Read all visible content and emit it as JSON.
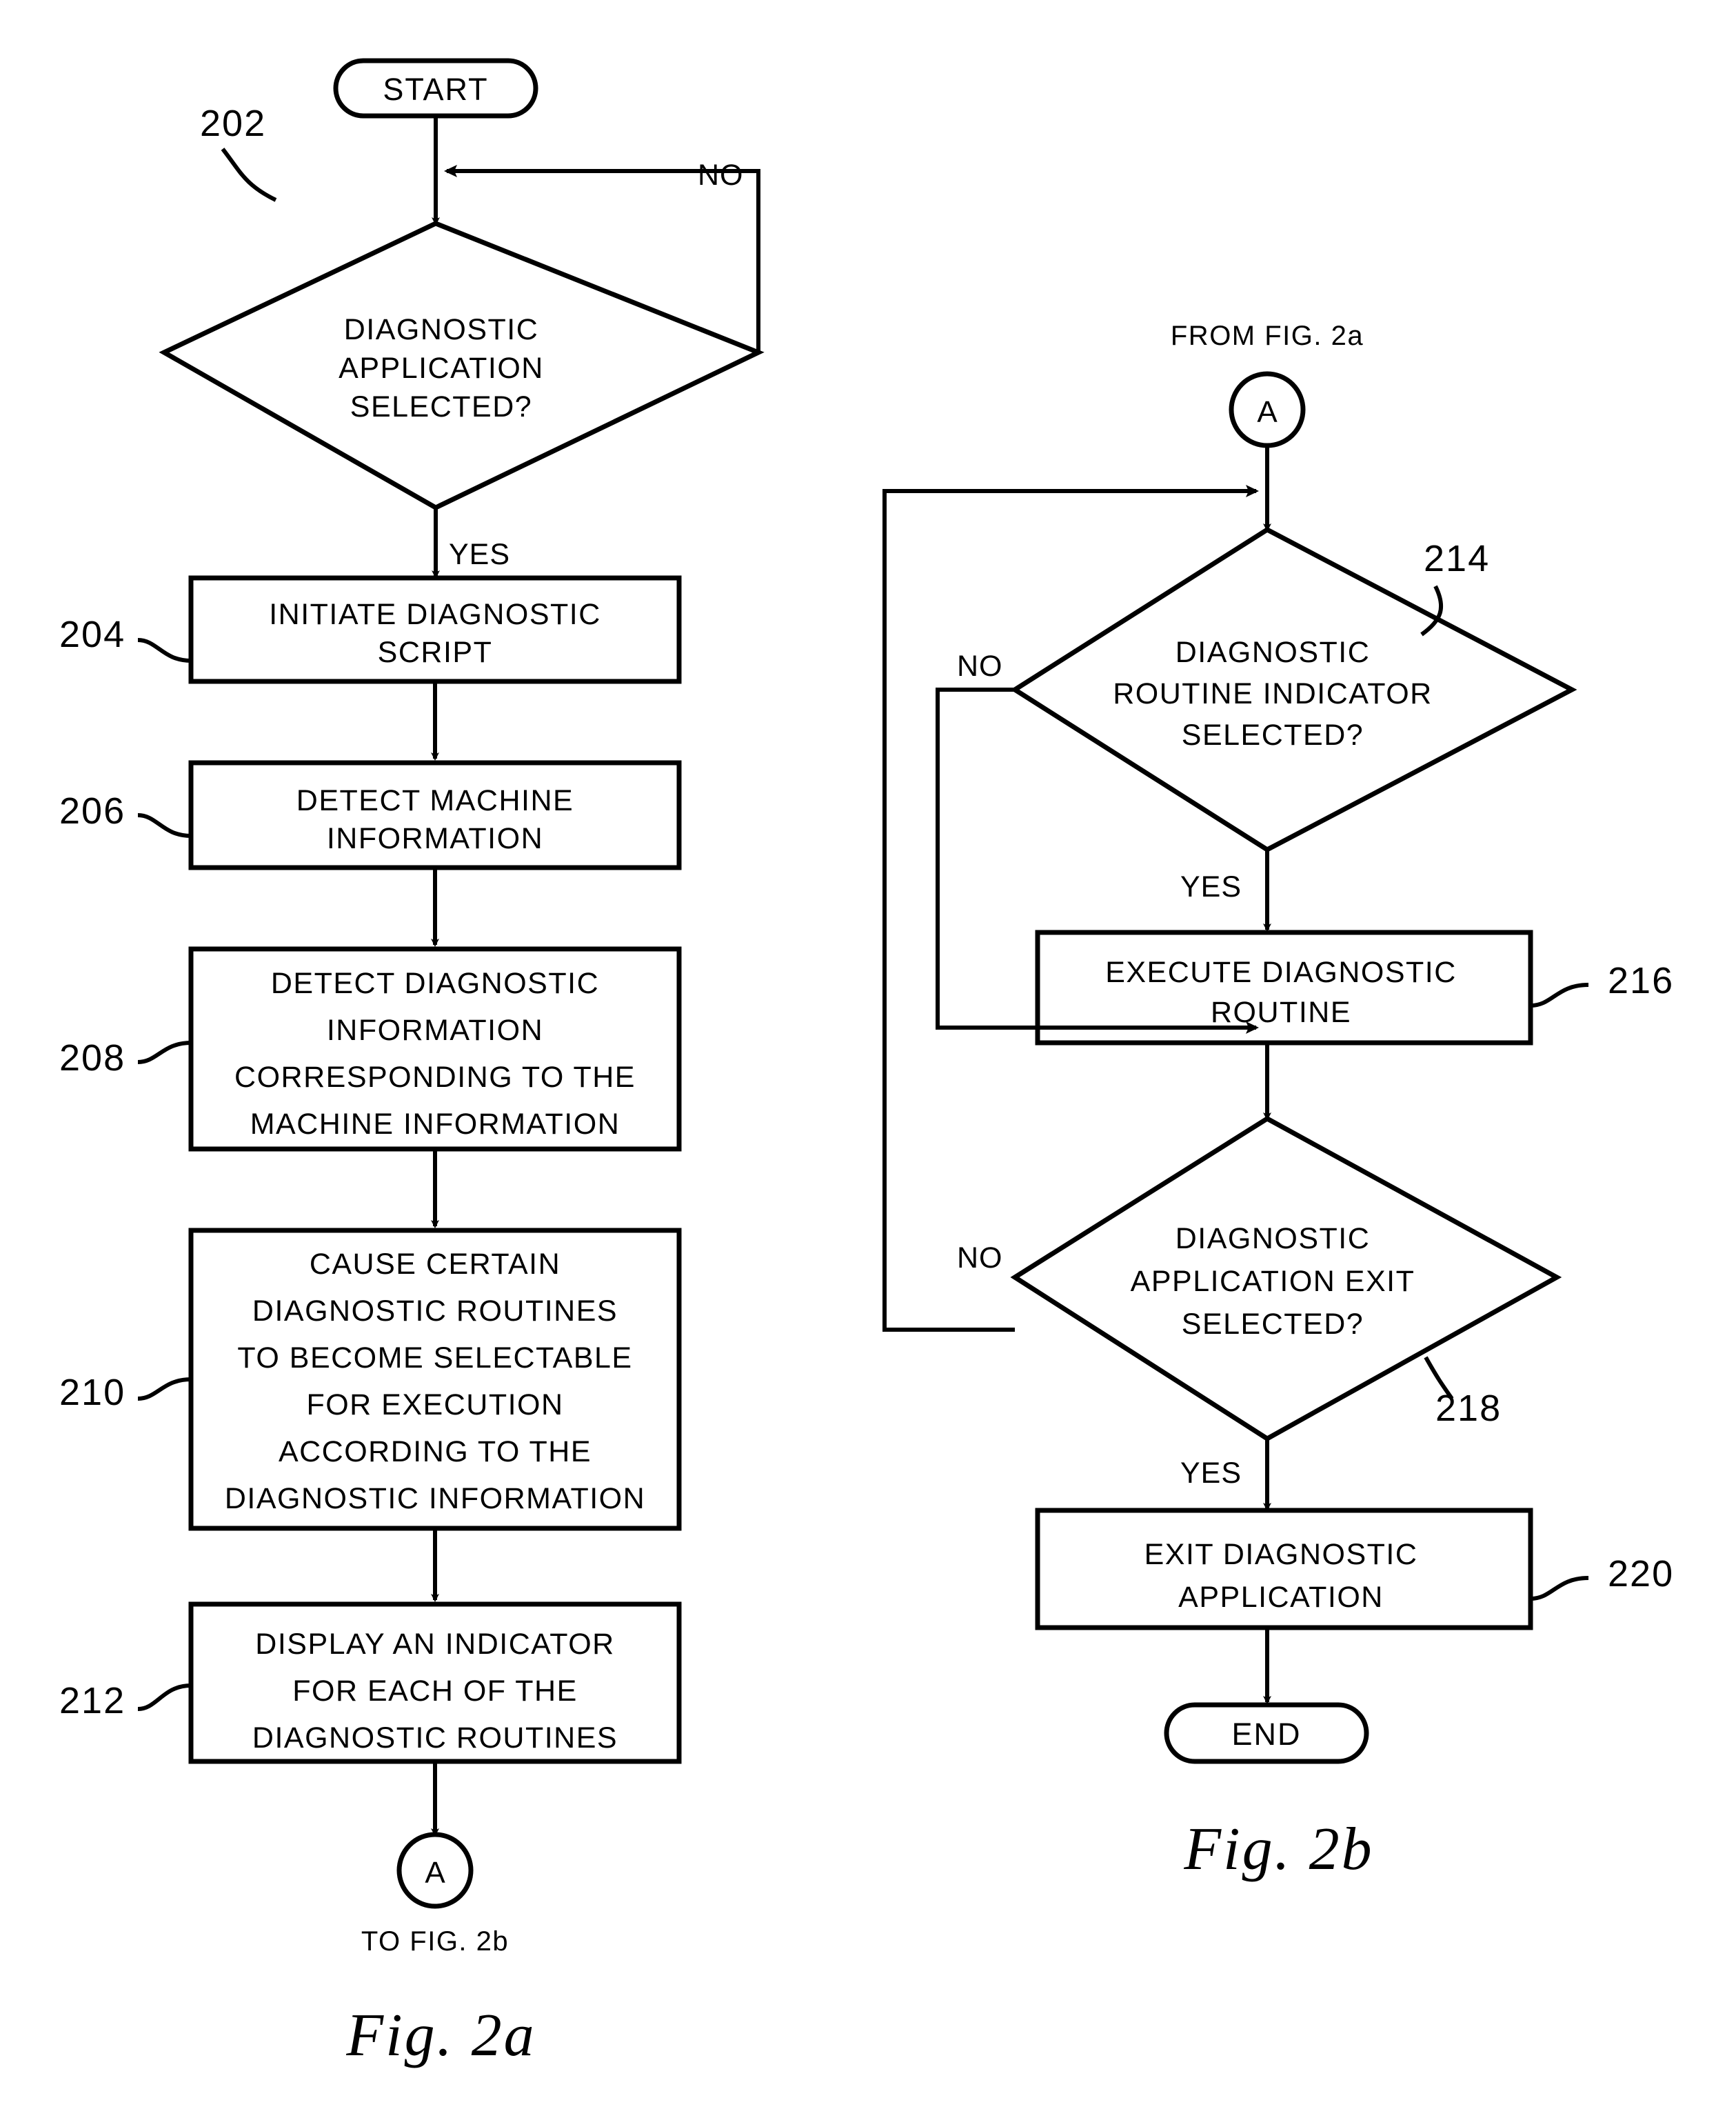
{
  "figure": {
    "left_caption": "Fig.  2a",
    "right_caption": "Fig.  2b"
  },
  "fig2a": {
    "start_label": "START",
    "decision_202": {
      "ref": "202",
      "line1": "DIAGNOSTIC",
      "line2": "APPLICATION",
      "line3": "SELECTED?",
      "no_label": "NO",
      "yes_label": "YES"
    },
    "box_204": {
      "ref": "204",
      "line1": "INITIATE DIAGNOSTIC",
      "line2": "SCRIPT"
    },
    "box_206": {
      "ref": "206",
      "line1": "DETECT MACHINE",
      "line2": "INFORMATION"
    },
    "box_208": {
      "ref": "208",
      "line1": "DETECT DIAGNOSTIC",
      "line2": "INFORMATION",
      "line3": "CORRESPONDING TO THE",
      "line4": "MACHINE INFORMATION"
    },
    "box_210": {
      "ref": "210",
      "line1": "CAUSE CERTAIN",
      "line2": "DIAGNOSTIC ROUTINES",
      "line3": "TO BECOME SELECTABLE",
      "line4": "FOR EXECUTION",
      "line5": "ACCORDING TO THE",
      "line6": "DIAGNOSTIC INFORMATION"
    },
    "box_212": {
      "ref": "212",
      "line1": "DISPLAY AN INDICATOR",
      "line2": "FOR EACH OF THE",
      "line3": "DIAGNOSTIC ROUTINES"
    },
    "connector": {
      "label": "A",
      "caption": "TO FIG. 2b"
    }
  },
  "fig2b": {
    "connector": {
      "label": "A",
      "caption": "FROM FIG. 2a"
    },
    "decision_214": {
      "ref": "214",
      "line1": "DIAGNOSTIC",
      "line2": "ROUTINE INDICATOR",
      "line3": "SELECTED?",
      "no_label": "NO",
      "yes_label": "YES"
    },
    "box_216": {
      "ref": "216",
      "line1": "EXECUTE DIAGNOSTIC",
      "line2": "ROUTINE"
    },
    "decision_218": {
      "ref": "218",
      "line1": "DIAGNOSTIC",
      "line2": "APPLICATION EXIT",
      "line3": "SELECTED?",
      "no_label": "NO",
      "yes_label": "YES"
    },
    "box_220": {
      "ref": "220",
      "line1": "EXIT DIAGNOSTIC",
      "line2": "APPLICATION"
    },
    "end_label": "END"
  },
  "colors": {
    "ink": "#000000",
    "paper": "#ffffff"
  }
}
